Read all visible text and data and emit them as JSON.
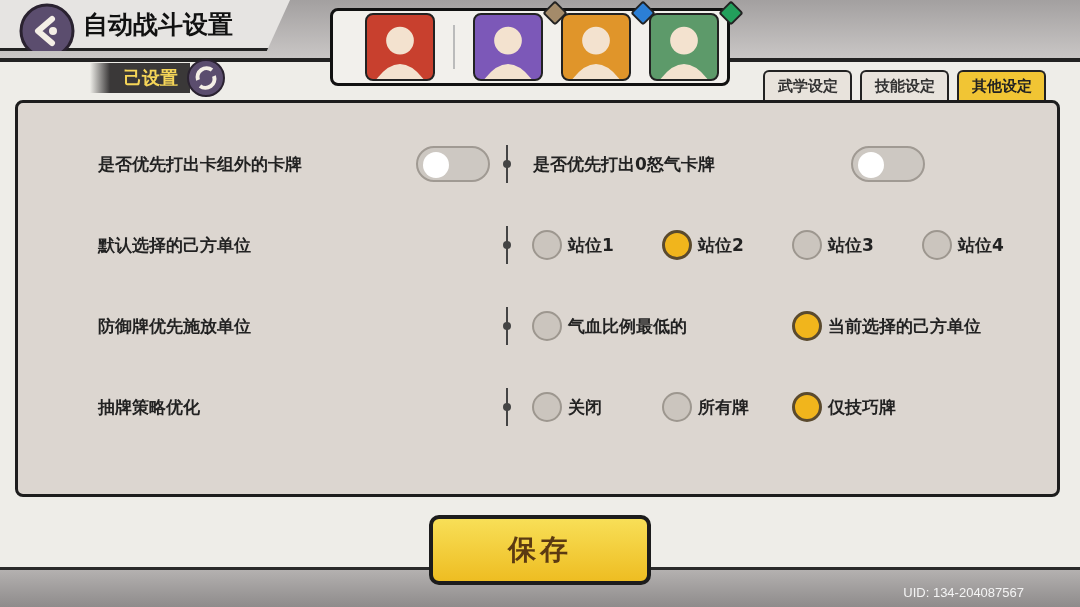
{
  "header": {
    "title": "自动战斗设置",
    "status": "己设置"
  },
  "team": [
    {
      "kind": "leader"
    },
    {
      "kind": "member",
      "color": "#a48b6a"
    },
    {
      "kind": "member",
      "color": "#2c7fd6"
    },
    {
      "kind": "member",
      "color": "#23a05c"
    }
  ],
  "tabs": [
    {
      "label": "武学设定",
      "selected": false
    },
    {
      "label": "技能设定",
      "selected": false
    },
    {
      "label": "其他设定",
      "selected": true
    }
  ],
  "settings": [
    {
      "kind": "toggle_pair",
      "items": [
        {
          "label": "是否优先打出卡组外的卡牌",
          "on": false
        },
        {
          "label": "是否优先打出0怒气卡牌",
          "on": false
        }
      ]
    },
    {
      "kind": "radio",
      "label": "默认选择的己方单位",
      "options": [
        {
          "label": "站位1",
          "selected": false
        },
        {
          "label": "站位2",
          "selected": true
        },
        {
          "label": "站位3",
          "selected": false
        },
        {
          "label": "站位4",
          "selected": false
        }
      ]
    },
    {
      "kind": "radio",
      "label": "防御牌优先施放单位",
      "options": [
        {
          "label": "气血比例最低的",
          "selected": false
        },
        {
          "label": "当前选择的己方单位",
          "selected": true
        }
      ]
    },
    {
      "kind": "radio",
      "label": "抽牌策略优化",
      "options": [
        {
          "label": "关闭",
          "selected": false
        },
        {
          "label": "所有牌",
          "selected": false
        },
        {
          "label": "仅技巧牌",
          "selected": true
        }
      ]
    }
  ],
  "save": "保存",
  "uid": "UID: 134-204087567"
}
